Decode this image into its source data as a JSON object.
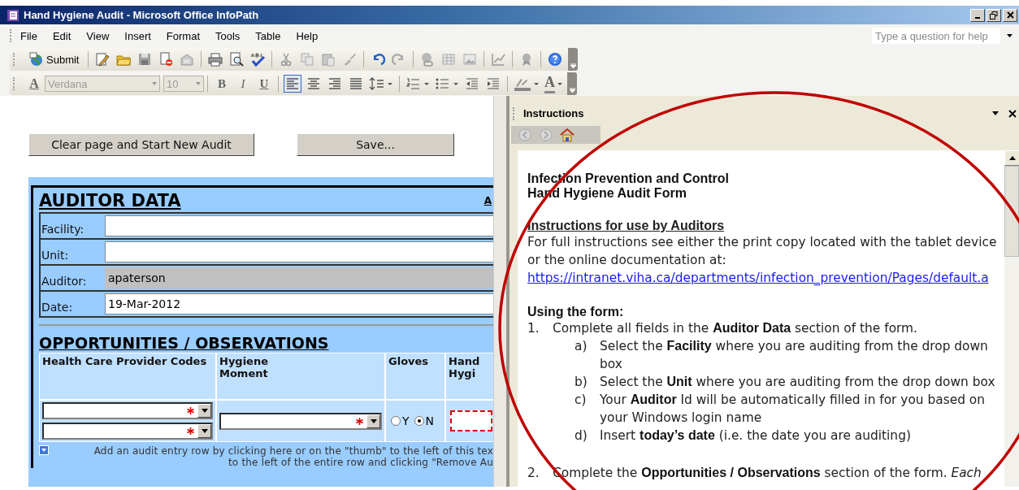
{
  "window": {
    "title": "Hand Hygiene Audit - Microsoft Office InfoPath"
  },
  "menu_bar": {
    "items": [
      "File",
      "Edit",
      "View",
      "Insert",
      "Format",
      "Tools",
      "Table",
      "Help"
    ],
    "help_box": {
      "placeholder": "Type a question for help"
    }
  },
  "standard_toolbar": {
    "submit_label": "Submit"
  },
  "formatting_toolbar": {
    "styles_label": "A",
    "font": "Verdana",
    "size": "10",
    "text_buttons": [
      {
        "label": "B",
        "kind": "bold"
      },
      {
        "label": "I",
        "kind": "italic"
      },
      {
        "label": "U",
        "kind": "underline"
      }
    ],
    "alignment_buttons": [
      {
        "selected": true
      },
      {
        "selected": false
      },
      {
        "selected": false
      },
      {
        "selected": false
      }
    ],
    "font_color_label": "A"
  },
  "form": {
    "buttons": [
      "Clear page and Start New Audit",
      "Save..."
    ],
    "auditor_data": {
      "heading": "AUDITOR DATA",
      "corner_link": "A",
      "fields": [
        {
          "label": "Facility:",
          "disabled": false
        },
        {
          "label": "Unit:",
          "disabled": false
        },
        {
          "label": "Auditor:",
          "value": "apaterson",
          "disabled": true
        },
        {
          "label": "Date:",
          "value": "19-Mar-2012",
          "disabled": false
        }
      ]
    },
    "opportunities": {
      "heading": "OPPORTUNITIES / OBSERVATIONS",
      "columns": [
        "Health Care Provider Codes",
        "Hygiene\nMoment",
        "Gloves",
        "Hand\nHygi"
      ],
      "gloves_options": [
        {
          "label": "Y",
          "selected": false
        },
        {
          "label": "N",
          "selected": true
        }
      ],
      "add_row_hint": [
        "Add an audit entry row by clicking here or on the \"thumb\" to the left of this tex",
        "to the left of the entire row and clicking \"Remove Au"
      ]
    }
  },
  "task_pane": {
    "title": "Instructions",
    "title_lines": [
      "Infection Prevention and Control",
      "Hand Hygiene Audit Form"
    ],
    "subheading": "Instructions for use by Auditors",
    "paragraph": "For full instructions see either the print copy located with the tablet device or the online documentation at:",
    "link": "https://intranet.viha.ca/departments/infection_prevention/Pages/default.a",
    "steps_heading": "Using the form:",
    "steps": [
      {
        "number": "1.",
        "text": "Complete all fields in the **Auditor Data** section of the form.",
        "children": [
          {
            "number": "a)",
            "text": "Select the **Facility** where you are auditing from the drop down box"
          },
          {
            "number": "b)",
            "text": "Select the **Unit** where you are auditing from the drop down box"
          },
          {
            "number": "c)",
            "text": "Your **Auditor** Id will be automatically filled in for you based on your Windows login name"
          },
          {
            "number": "d)",
            "text": "Insert **today’s date** (i.e. the date you are auditing)"
          }
        ]
      },
      {
        "number": "2.",
        "text": "Complete the **Opportunities / Observations** section of the form. *Each*"
      }
    ]
  }
}
